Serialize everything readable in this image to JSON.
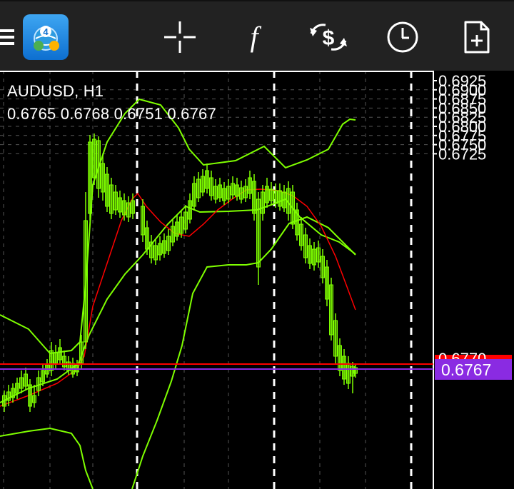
{
  "toolbar": {
    "menu_icon": "hamburger-menu-icon",
    "app_icon": "metatrader-4-app-icon",
    "app_icon_badge": "4",
    "tools": [
      {
        "name": "crosshair-icon"
      },
      {
        "name": "indicators-f-icon",
        "glyph": "f"
      },
      {
        "name": "trade-dollar-icon"
      },
      {
        "name": "timeframe-clock-icon"
      },
      {
        "name": "new-order-document-icon"
      }
    ]
  },
  "chart": {
    "symbol_timeframe": "AUDUSD, H1",
    "ohlc": "0.6765 0.6768 0.6751 0.6767",
    "price_scale": [
      "0.6925",
      "0.6900",
      "0.6875",
      "0.6850",
      "0.6825",
      "0.6800",
      "0.6775",
      "0.6750",
      "0.6725"
    ],
    "bid_label": "0.6767",
    "ask_label": "0.6770",
    "colors": {
      "background": "#000000",
      "candles": "#7FFF00",
      "bollinger": "#7FFF00",
      "moving_average": "#FF0000",
      "ask_line": "#FF0000",
      "bid_line": "#8A2BE2",
      "grid": "#555555",
      "separator": "#FFFFFF"
    }
  }
}
